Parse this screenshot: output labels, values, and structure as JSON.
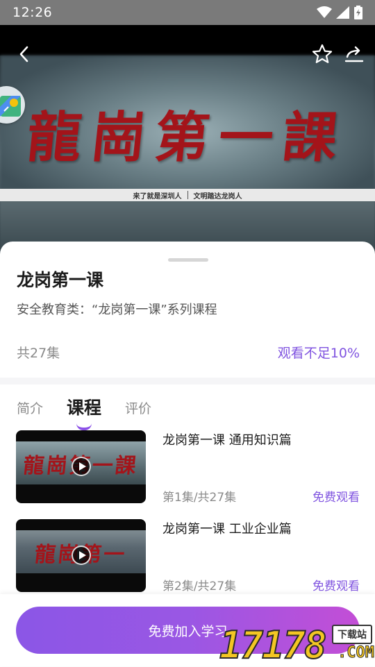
{
  "status_bar": {
    "time": "12:26",
    "icons": [
      "wifi-icon",
      "signal-icon",
      "battery-icon"
    ]
  },
  "hero": {
    "calligraphy": "龍崗第一課",
    "caption_left": "来了就是深圳人",
    "caption_right": "文明踏达龙岗人",
    "icons": [
      "back-arrow-icon",
      "star-icon",
      "share-icon"
    ]
  },
  "course": {
    "title": "龙岗第一课",
    "description": "安全教育类：“龙岗第一课”系列课程",
    "episode_count": "共27集",
    "progress": "观看不足10%"
  },
  "tabs": [
    {
      "label": "简介",
      "active": false
    },
    {
      "label": "课程",
      "active": true
    },
    {
      "label": "评价",
      "active": false
    }
  ],
  "episodes": [
    {
      "title": "龙岗第一课 通用知识篇",
      "index": "第1集/共27集",
      "action": "免费观看",
      "thumb_text": "龍崗第一課"
    },
    {
      "title": "龙岗第一课 工业企业篇",
      "index": "第2集/共27集",
      "action": "免费观看",
      "thumb_text": "龍崗第一"
    }
  ],
  "bottom": {
    "join_label": "免费加入学习"
  },
  "watermark": {
    "number": "17178",
    "tag": "下载站",
    "domain": ".COM"
  },
  "colors": {
    "accent": "#8054e0",
    "button_start": "#8b56e6",
    "button_end": "#c34ed6",
    "status_bar": "#7a7a7a"
  }
}
